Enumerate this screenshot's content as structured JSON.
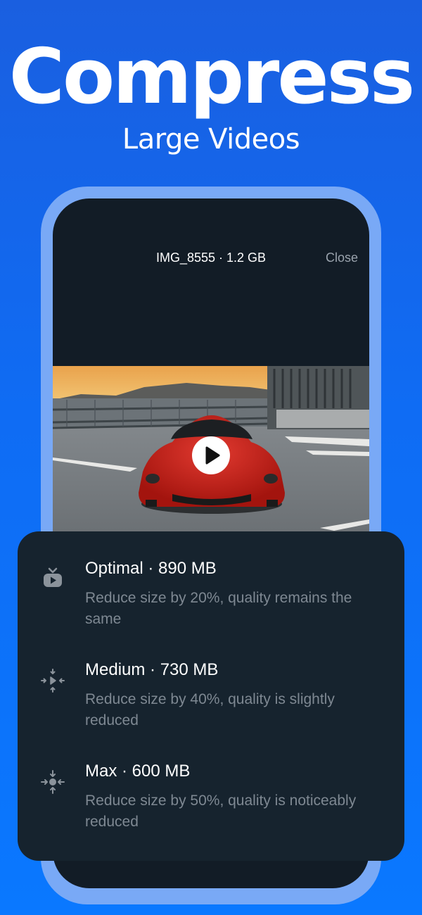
{
  "promo": {
    "headline": "Compress",
    "subheadline": "Large Videos"
  },
  "header": {
    "file_title": "IMG_8555 · 1.2 GB",
    "close_label": "Close"
  },
  "options": [
    {
      "icon": "video-play-icon",
      "title": "Optimal · 890 MB",
      "description": "Reduce size by 20%, quality remains the same"
    },
    {
      "icon": "compress-inward-icon",
      "title": "Medium · 730 MB",
      "description": "Reduce size by 40%, quality is slightly reduced"
    },
    {
      "icon": "compress-max-icon",
      "title": "Max · 600 MB",
      "description": "Reduce size by 50%, quality is noticeably reduced"
    }
  ],
  "colors": {
    "background": "#0f6cf4",
    "phone_frame": "#79a9f6",
    "screen": "#121c26",
    "card": "#16232e",
    "description_text": "#7e8892"
  }
}
